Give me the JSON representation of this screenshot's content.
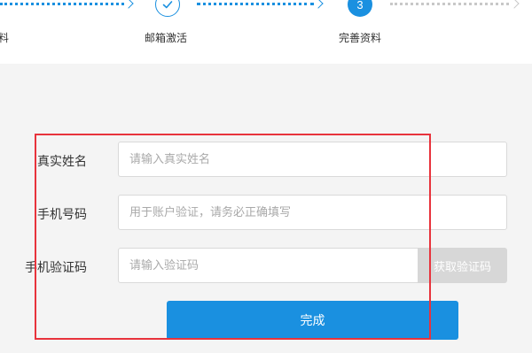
{
  "stepper": {
    "steps": [
      {
        "label": "资料",
        "state": "done"
      },
      {
        "label": "邮箱激活",
        "state": "done",
        "icon": "check-icon"
      },
      {
        "label": "完善资料",
        "number": "3",
        "state": "active"
      }
    ]
  },
  "form": {
    "name": {
      "label": "真实姓名",
      "placeholder": "请输入真实姓名"
    },
    "phone": {
      "label": "手机号码",
      "placeholder": "用于账户验证，请务必正确填写"
    },
    "code": {
      "label": "手机验证码",
      "placeholder": "请输入验证码",
      "button_label": "获取验证码"
    },
    "submit_label": "完成"
  },
  "colors": {
    "accent": "#1a90e0",
    "disabled_button": "#d7d7d7",
    "highlight_border": "#e8333c",
    "background": "#f4f4f4"
  }
}
